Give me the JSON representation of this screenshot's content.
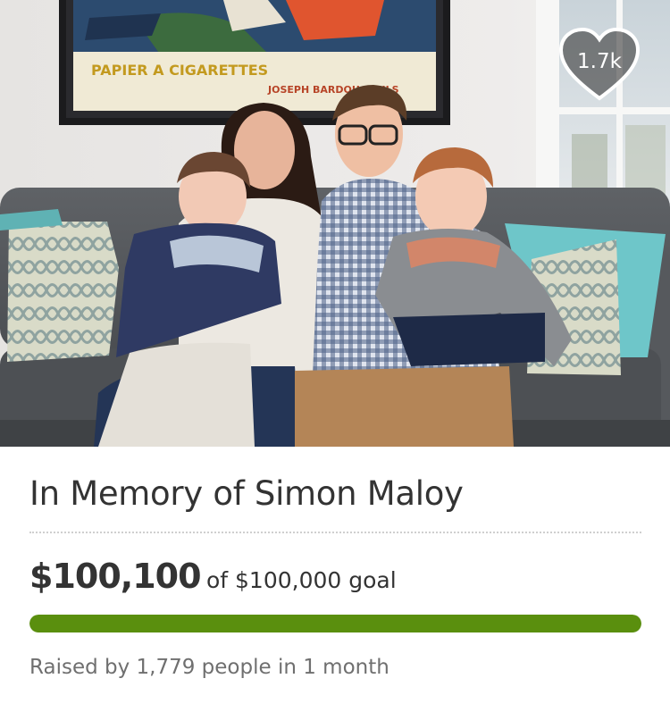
{
  "campaign": {
    "title": "In Memory of Simon Maloy",
    "amount_raised": "$100,100",
    "goal_text": "of $100,000 goal",
    "progress_fraction": 1.0,
    "raised_by_text": "Raised by 1,779 people in 1 month",
    "likes_count": "1.7k",
    "like_icon": "heart-icon"
  },
  "hero_image": {
    "poster_line1": "PAPIER A CIGARETTES",
    "poster_line2": "JOSEPH BARDOU & FILS"
  },
  "colors": {
    "progress_fill": "#5a8f0e",
    "progress_track": "#e6e6e6",
    "title_text": "#333333",
    "muted_text": "#6f6f6f"
  }
}
